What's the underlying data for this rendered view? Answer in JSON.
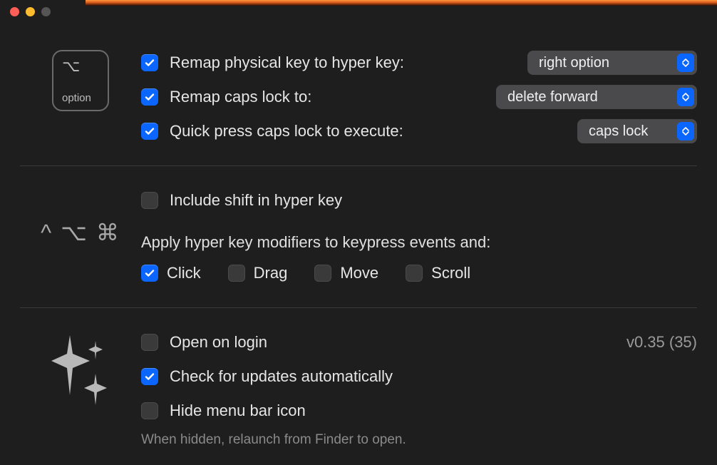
{
  "keycap": {
    "glyph": "⌥",
    "label": "option"
  },
  "hyper": {
    "remap_physical": {
      "label": "Remap physical key to hyper key:",
      "checked": true,
      "select": "right option"
    },
    "remap_caps": {
      "label": "Remap caps lock to:",
      "checked": true,
      "select": "delete forward"
    },
    "quick_press": {
      "label": "Quick press caps lock to execute:",
      "checked": true,
      "select": "caps lock"
    }
  },
  "modifiers": {
    "glyphs": "^ ⌥ ⌘",
    "include_shift": {
      "label": "Include shift in hyper key",
      "checked": false
    },
    "apply_heading": "Apply hyper key modifiers to keypress events and:",
    "click": {
      "label": "Click",
      "checked": true
    },
    "drag": {
      "label": "Drag",
      "checked": false
    },
    "move": {
      "label": "Move",
      "checked": false
    },
    "scroll": {
      "label": "Scroll",
      "checked": false
    }
  },
  "app": {
    "open_on_login": {
      "label": "Open on login",
      "checked": false
    },
    "check_updates": {
      "label": "Check for updates automatically",
      "checked": true
    },
    "hide_menu_bar": {
      "label": "Hide menu bar icon",
      "checked": false
    },
    "hint": "When hidden, relaunch from Finder to open.",
    "version": "v0.35 (35)"
  }
}
